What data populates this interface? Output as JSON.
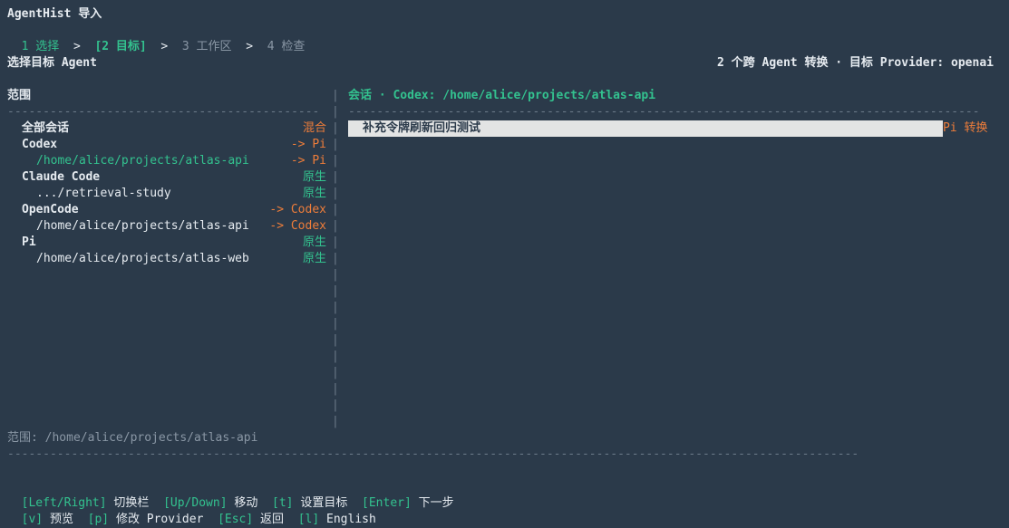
{
  "app": {
    "title": "AgentHist 导入"
  },
  "stepper": {
    "steps": [
      {
        "label": "1 选择",
        "state": "done"
      },
      {
        "label": "[2 目标]",
        "state": "current"
      },
      {
        "label": "3 工作区",
        "state": "pending"
      },
      {
        "label": "4 检查",
        "state": "pending"
      }
    ],
    "separator": ">"
  },
  "sub_header": {
    "left": "选择目标 Agent",
    "right": "2 个跨 Agent 转换 · 目标 Provider: openai"
  },
  "scope_pane": {
    "title": "范围",
    "separator": "--------------------------------------------",
    "rows": [
      {
        "label": "全部会话",
        "tag": "混合",
        "indent": 1,
        "bold": true,
        "tag_color": "orange",
        "label_color": "white"
      },
      {
        "label": "Codex",
        "tag": "-> Pi",
        "indent": 1,
        "bold": true,
        "tag_color": "orange",
        "label_color": "white"
      },
      {
        "label": "/home/alice/projects/atlas-api",
        "tag": "-> Pi",
        "indent": 2,
        "bold": false,
        "tag_color": "orange",
        "label_color": "green"
      },
      {
        "label": "Claude Code",
        "tag": "原生",
        "indent": 1,
        "bold": true,
        "tag_color": "green",
        "label_color": "white"
      },
      {
        "label": ".../retrieval-study",
        "tag": "原生",
        "indent": 2,
        "bold": false,
        "tag_color": "green",
        "label_color": "white"
      },
      {
        "label": "OpenCode",
        "tag": "-> Codex",
        "indent": 1,
        "bold": true,
        "tag_color": "orange",
        "label_color": "white"
      },
      {
        "label": "/home/alice/projects/atlas-api",
        "tag": "-> Codex",
        "indent": 2,
        "bold": false,
        "tag_color": "orange",
        "label_color": "white"
      },
      {
        "label": "Pi",
        "tag": "原生",
        "indent": 1,
        "bold": true,
        "tag_color": "green",
        "label_color": "white"
      },
      {
        "label": "/home/alice/projects/atlas-web",
        "tag": "原生",
        "indent": 2,
        "bold": false,
        "tag_color": "green",
        "label_color": "white"
      }
    ]
  },
  "session_pane": {
    "title": "会话 · Codex: /home/alice/projects/atlas-api",
    "separator": "-----------------------------------------------------------------------------------------",
    "sessions": [
      {
        "label": "补充令牌刷新回归测试",
        "tag": "Pi 转换"
      }
    ]
  },
  "divider": {
    "char": "|",
    "separator_char": "|"
  },
  "footer": {
    "scope_text": "范围: /home/alice/projects/atlas-api",
    "separator": "------------------------------------------------------------------------------------------------------------------------",
    "help_row1": [
      {
        "key": "[Left/Right]",
        "hint": "切换栏"
      },
      {
        "key": "[Up/Down]",
        "hint": "移动"
      },
      {
        "key": "[t]",
        "hint": "设置目标"
      },
      {
        "key": "[Enter]",
        "hint": "下一步"
      }
    ],
    "help_row2": [
      {
        "key": "[v]",
        "hint": "预览"
      },
      {
        "key": "[p]",
        "hint": "修改 Provider"
      },
      {
        "key": "[Esc]",
        "hint": "返回"
      },
      {
        "key": "[l]",
        "hint": "English"
      }
    ]
  },
  "colors": {
    "background": "#2b3a4a",
    "accent_green": "#33c28f",
    "accent_orange": "#ee7d3a",
    "selection_bg": "#e3e4e4"
  }
}
